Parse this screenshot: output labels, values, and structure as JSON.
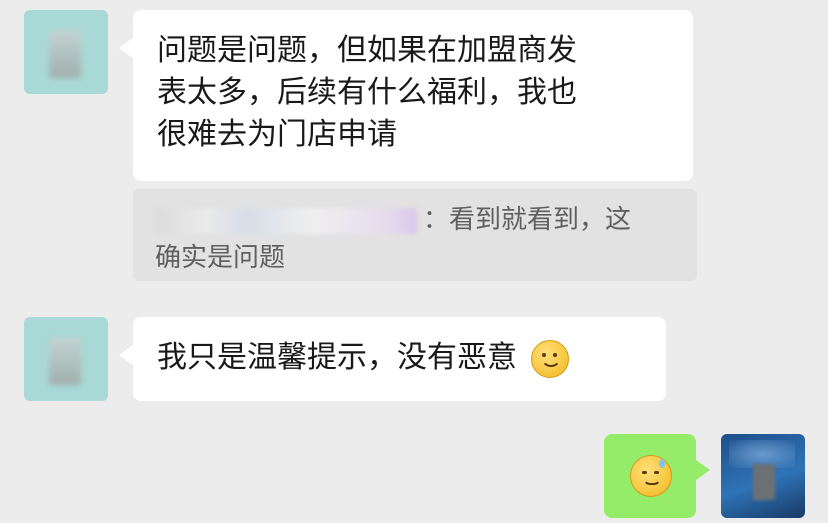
{
  "messages": [
    {
      "sender": "left",
      "lines": [
        "问题是问题，但如果在加盟商发",
        "表太多，后续有什么福利，我也",
        "很难去为门店申请"
      ]
    },
    {
      "quote_suffix": "：看到就看到，这",
      "quote_line2": "确实是问题"
    },
    {
      "sender": "left",
      "text": "我只是温馨提示，没有恶意",
      "emoji": "smiling-face-emoji"
    },
    {
      "sender": "right",
      "emoji": "sweat-smile-emoji"
    }
  ],
  "colors": {
    "background": "#ececec",
    "incoming_bubble": "#ffffff",
    "outgoing_bubble": "#95ec69",
    "quote_bubble": "#e2e2e2"
  }
}
